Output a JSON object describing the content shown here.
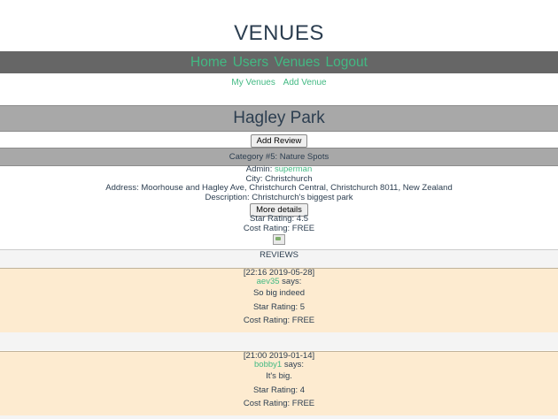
{
  "page": {
    "title": "VENUES"
  },
  "nav": {
    "home": "Home",
    "users": "Users",
    "venues": "Venues",
    "logout": "Logout"
  },
  "subnav": {
    "my_venues": "My Venues",
    "add_venue": "Add Venue"
  },
  "venue": {
    "name": "Hagley Park",
    "add_review_label": "Add Review",
    "category": "Category #5: Nature Spots",
    "admin_label": "Admin:",
    "admin_name": "superman",
    "city": "City: Christchurch",
    "address": "Address: Moorhouse and Hagley Ave, Christchurch Central, Christchurch 8011, New Zealand",
    "description": "Description: Christchurch's biggest park",
    "more_details_label": "More details",
    "star_rating": "Star Rating: 4.5",
    "cost_rating": "Cost Rating: FREE"
  },
  "reviews": {
    "title": "REVIEWS",
    "items": [
      {
        "date": "[22:16 2019-05-28]",
        "user": "aev35",
        "says": "says:",
        "text": "So big indeed",
        "star": "Star Rating: 5",
        "cost": "Cost Rating: FREE"
      },
      {
        "date": "[21:00 2019-01-14]",
        "user": "bobby1",
        "says": "says:",
        "text": "It's big.",
        "star": "Star Rating: 4",
        "cost": "Cost Rating: FREE"
      }
    ]
  },
  "colors": {
    "link": "#42b983",
    "nav_bg": "#666666",
    "header_bg": "#a8a8a8",
    "review_bg": "#fdebd0",
    "text": "#2c3e50"
  }
}
